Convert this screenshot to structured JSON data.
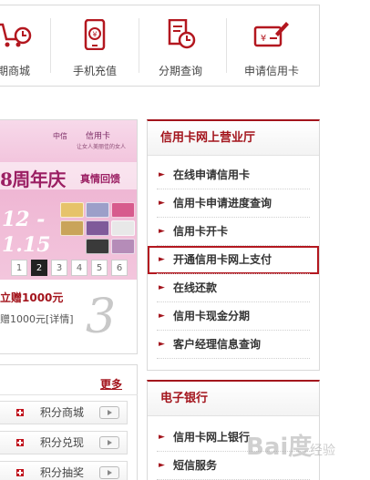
{
  "top_menu": {
    "items": [
      {
        "label": "期商城",
        "icon": "shopping-clock-icon"
      },
      {
        "label": "手机充值",
        "icon": "phone-yen-icon"
      },
      {
        "label": "分期查询",
        "icon": "document-clock-icon"
      },
      {
        "label": "申请信用卡",
        "icon": "card-pen-icon"
      }
    ]
  },
  "banner": {
    "brand_bank": "中信",
    "brand_card": "信用卡",
    "slogan": "让女人美丽佳的女人",
    "anniversary": "8周年庆",
    "anniversary_sub": "真情回馈",
    "date_line1": "12 -",
    "date_line2": "1.15",
    "pages": [
      "1",
      "2",
      "3",
      "4",
      "5",
      "6"
    ],
    "active_page": "2",
    "promo_title": "立赠1000元",
    "promo_sub": "赠1000元[详情]",
    "promo_number": "3"
  },
  "business_hall": {
    "title": "信用卡网上营业厅",
    "items": [
      {
        "label": "在线申请信用卡"
      },
      {
        "label": "信用卡申请进度查询"
      },
      {
        "label": "信用卡开卡"
      },
      {
        "label": "开通信用卡网上支付",
        "highlighted": true
      },
      {
        "label": "在线还款"
      },
      {
        "label": "信用卡现金分期"
      },
      {
        "label": "客户经理信息查询"
      }
    ]
  },
  "points": {
    "more_label": "更多",
    "items": [
      {
        "label": "积分商城"
      },
      {
        "label": "积分兑现"
      },
      {
        "label": "积分抽奖"
      }
    ]
  },
  "ebank": {
    "title": "电子银行",
    "items": [
      {
        "label": "信用卡网上银行"
      },
      {
        "label": "短信服务"
      }
    ]
  },
  "watermark": {
    "text": "Bai度",
    "sub": "经验"
  },
  "colors": {
    "accent": "#a3141c",
    "banner_pink": "#efb7d4"
  }
}
